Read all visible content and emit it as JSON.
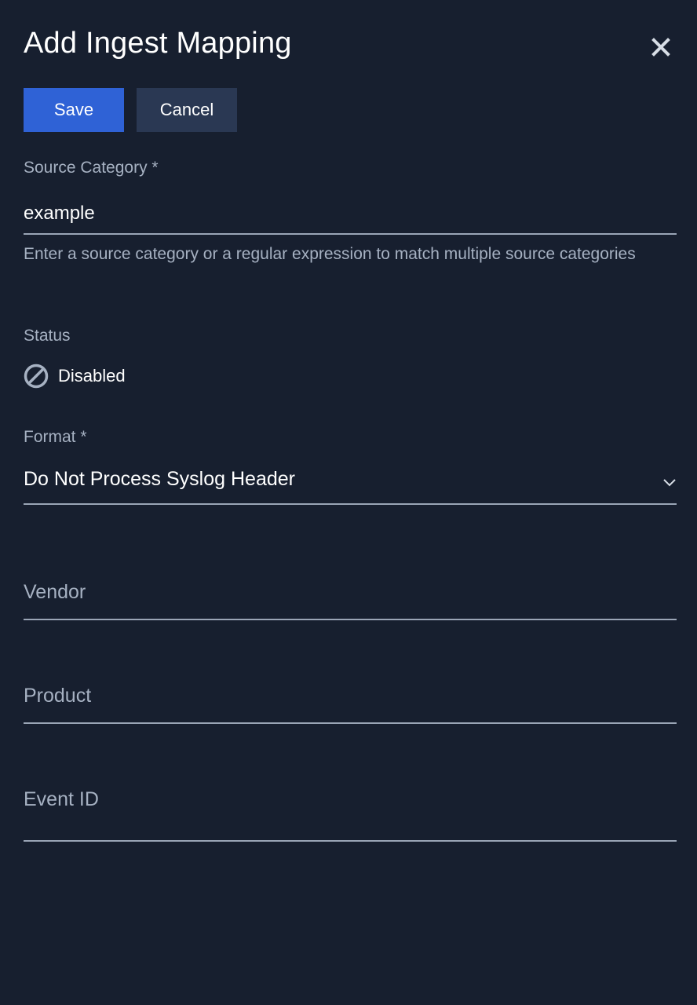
{
  "dialog": {
    "title": "Add Ingest Mapping",
    "close_icon": "close-icon"
  },
  "toolbar": {
    "save_label": "Save",
    "cancel_label": "Cancel"
  },
  "source_category": {
    "label": "Source Category *",
    "value": "example",
    "helper": "Enter a source category or a regular expression to match multiple source categories"
  },
  "status": {
    "label": "Status",
    "value": "Disabled",
    "icon": "disabled-icon"
  },
  "format": {
    "label": "Format *",
    "selected": "Do Not Process Syslog Header",
    "icon": "chevron-down-icon"
  },
  "vendor": {
    "placeholder": "Vendor"
  },
  "product": {
    "placeholder": "Product"
  },
  "event_id": {
    "placeholder": "Event ID"
  },
  "colors": {
    "background": "#171f2f",
    "primary": "#2f62d6",
    "secondary_button": "#2a3853",
    "muted_text": "#a6b1c2",
    "line": "#9aa5b6"
  }
}
